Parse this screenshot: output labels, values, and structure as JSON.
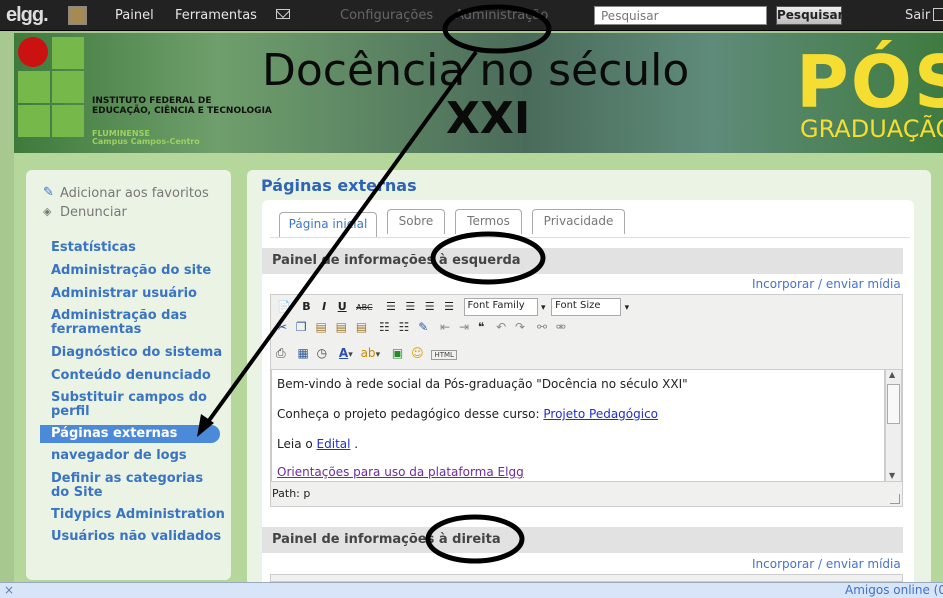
{
  "topbar": {
    "logo": "elgg.",
    "items": [
      "Painel",
      "Ferramentas",
      "Configurações",
      "Administração"
    ],
    "search_placeholder": "Pesquisar",
    "search_button": "Pesquisar",
    "logout": "Sair"
  },
  "banner": {
    "institution_line1": "INSTITUTO FEDERAL DE",
    "institution_line2": "EDUCAÇÃO, CIÊNCIA E TECNOLOGIA",
    "institution_line3": "FLUMINENSE",
    "institution_line4": "Campus Campos-Centro",
    "title_line1": "Docência no século",
    "title_line2": "XXI",
    "pos": "PÓS",
    "grad": "GRADUAÇÃO"
  },
  "sidebar": {
    "favorite": "Adicionar aos favoritos",
    "report": "Denunciar",
    "links": [
      "Estatísticas",
      "Administração do site",
      "Administrar usuário",
      "Administração das ferramentas",
      "Diagnóstico do sistema",
      "Conteúdo denunciado",
      "Substituir campos do perfil",
      "Páginas externas",
      "navegador de logs",
      "Definir as categorias do Site",
      "Tidypics Administration",
      "Usuários não validados"
    ]
  },
  "content": {
    "title": "Páginas externas",
    "tabs": [
      "Página inicial",
      "Sobre",
      "Termos",
      "Privacidade"
    ],
    "left_panel_title": "Painel de informações à esquerda",
    "right_panel_title": "Painel de informações à direita",
    "media_link": "Incorporar / enviar mídia",
    "toolbar": {
      "font_family": "Font Family",
      "font_size": "Font Size",
      "html": "HTML"
    },
    "editor": {
      "line1": "Bem-vindo à rede social da Pós-graduação \"Docência no século XXI\"",
      "line2_prefix": "Conheça o projeto pedagógico desse curso:",
      "line2_link": "Projeto Pedagógico",
      "line3_prefix": "Leia o",
      "line3_link": "Edital",
      "line3_suffix": ".",
      "line4_link": "Orientações para uso da plataforma Elgg",
      "path": "Path: p"
    }
  },
  "statusbar": {
    "friends": "Amigos online (0"
  },
  "colors": {
    "accent": "#3a74c4",
    "active_item": "#4a8ad8",
    "page_bg": "#b6d79c",
    "topbar_bg": "#222222"
  }
}
